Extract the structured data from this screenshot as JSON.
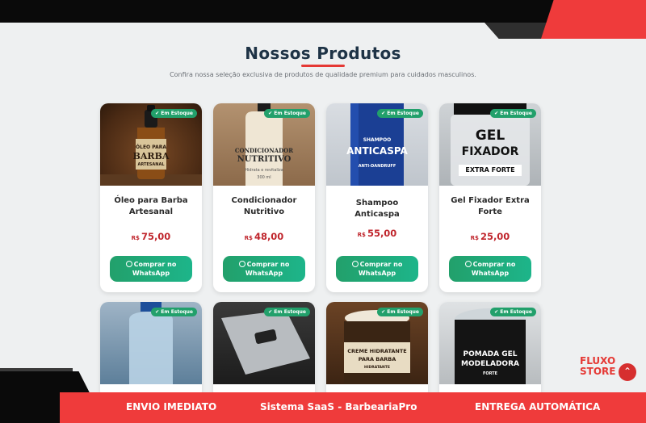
{
  "section": {
    "title": "Nossos Produtos",
    "subtitle": "Confira nossa seleção exclusiva de produtos de qualidade premium para cuidados masculinos."
  },
  "products": [
    {
      "badge": "✔ Em Estoque",
      "name": "Óleo para Barba Artesanal",
      "currency": "R$",
      "price": "75,00",
      "button": "Comprar no WhatsApp",
      "label_lines": [
        "ÓLEO PARA",
        "BARBA",
        "ARTESANAL"
      ]
    },
    {
      "badge": "✔ Em Estoque",
      "name": "Condicionador Nutritivo",
      "currency": "R$",
      "price": "48,00",
      "button": "Comprar no WhatsApp",
      "label_lines": [
        "CONDICIONADOR",
        "NUTRITIVO",
        "Hidrata e revitaliza",
        "300 ml"
      ]
    },
    {
      "badge": "✔ Em Estoque",
      "name": "Shampoo Anticaspa",
      "currency": "R$",
      "price": "55,00",
      "button": "Comprar no WhatsApp",
      "label_lines": [
        "SHAMPOO",
        "ANTICASPA",
        "ANTI-DANDRUFF"
      ]
    },
    {
      "badge": "✔ Em Estoque",
      "name": "Gel Fixador Extra Forte",
      "currency": "R$",
      "price": "25,00",
      "button": "Comprar no WhatsApp",
      "label_lines": [
        "GEL",
        "FIXADOR",
        "EXTRA FORTE"
      ]
    },
    {
      "badge": "✔ Em Estoque"
    },
    {
      "badge": "✔ Em Estoque"
    },
    {
      "badge": "✔ Em Estoque",
      "label_lines": [
        "CREME HIDRATANTE",
        "PARA BARBA",
        "HIDRATANTE"
      ]
    },
    {
      "badge": "✔ Em Estoque",
      "label_lines": [
        "POMADA GEL",
        "MODELADORA",
        "FORTE"
      ]
    }
  ],
  "footer_banner": {
    "left": "ENVIO IMEDIATO",
    "center": "Sistema SaaS - BarbeariaPro",
    "right": "ENTREGA AUTOMÁTICA"
  },
  "brand": {
    "line1": "FLUXO",
    "line2": "STORE"
  },
  "scroll_top_icon": "chevron-up-icon",
  "colors": {
    "accent_red": "#ef3b3b",
    "title_navy": "#1e3346",
    "price_red": "#c0262d",
    "button_green": "#22a06b"
  }
}
